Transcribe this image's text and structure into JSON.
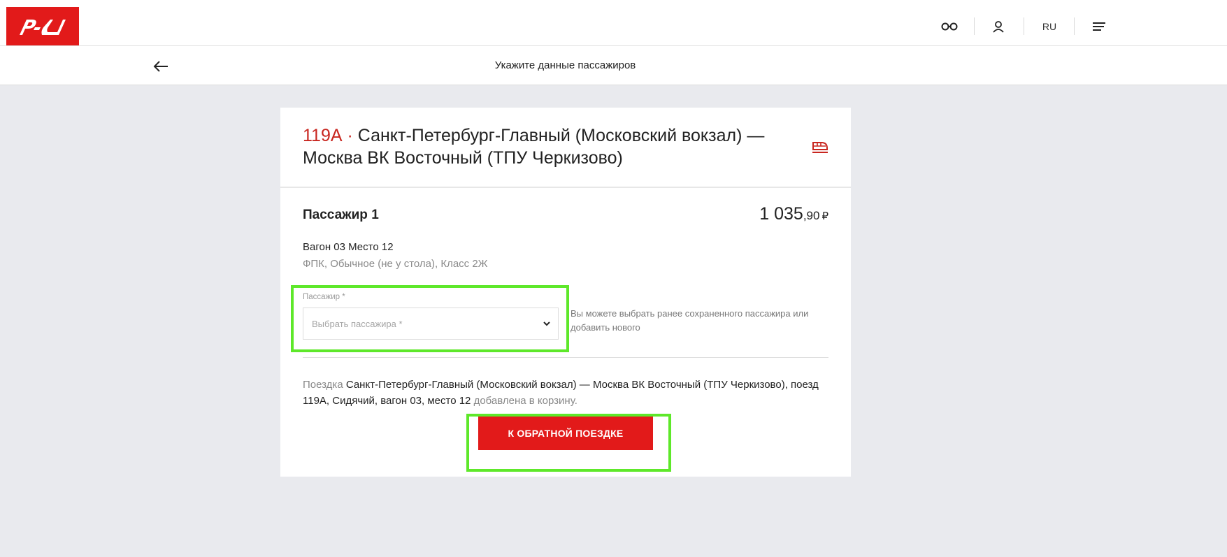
{
  "header": {
    "logo_text": "РЖД",
    "lang": "RU",
    "icons": [
      "glasses-icon",
      "user-icon",
      "menu-icon"
    ]
  },
  "subbar": {
    "title": "Укажите данные пассажиров"
  },
  "trip": {
    "train_number": "119А",
    "separator": " · ",
    "route": "Санкт-Петербург-Главный (Московский вокзал) — Москва ВК Восточный (ТПУ Черкизово)"
  },
  "passenger": {
    "title": "Пассажир 1",
    "price_main": "1 035",
    "price_cents": ",90",
    "currency": "₽",
    "seat": "Вагон 03 Место 12",
    "seat_desc": "ФПК, Обычное (не у стола), Класс 2Ж",
    "field_label": "Пассажир *",
    "select_placeholder": "Выбрать пассажира *",
    "hint": "Вы можете выбрать ранее сохраненного пассажира или добавить нового"
  },
  "note": {
    "prefix": "Поездка ",
    "trip_text": "Санкт-Петербург-Главный (Московский вокзал) — Москва ВК Восточный (ТПУ Черкизово), поезд 119А, Сидячий, вагон 03, место 12",
    "suffix": " добавлена в корзину."
  },
  "button": {
    "return_trip_label": "К ОБРАТНОЙ ПОЕЗДКЕ"
  },
  "colors": {
    "brand_red": "#e21a1a",
    "train_number_red": "#c8261f",
    "highlight_green": "#5ee82a",
    "page_bg": "#e9eaee"
  }
}
